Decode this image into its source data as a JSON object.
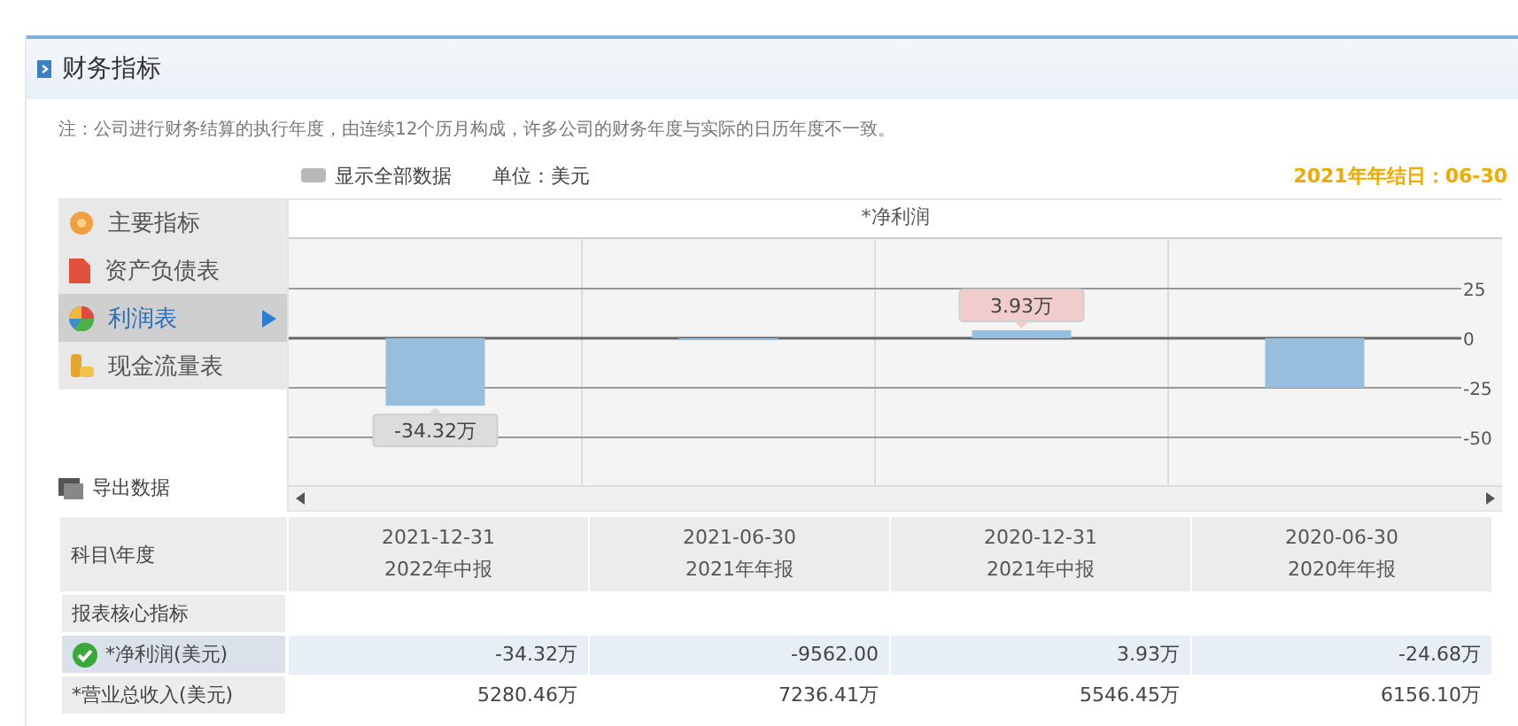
{
  "header": {
    "title": "财务指标"
  },
  "note": "注：公司进行财务结算的执行年度，由连续12个历月构成，许多公司的财务年度与实际的日历年度不一致。",
  "toolbar": {
    "toggle_label": "显示全部数据",
    "unit": "单位：美元",
    "year_end": "2021年年结日：06-30"
  },
  "menu": [
    {
      "label": "主要指标",
      "kind": "flower",
      "selected": false
    },
    {
      "label": "资产负债表",
      "kind": "sheet",
      "selected": false
    },
    {
      "label": "利润表",
      "kind": "ball",
      "selected": true
    },
    {
      "label": "现金流量表",
      "kind": "coins",
      "selected": false
    }
  ],
  "export_label": "导出数据",
  "chart": {
    "chart_data": {
      "type": "bar",
      "title": "*净利润",
      "series": [
        {
          "color": "#97bfdd",
          "values": [
            -34,
            -1,
            4,
            -25
          ]
        }
      ],
      "ylim": [
        -75,
        50
      ],
      "yticks": [
        25,
        0,
        -25,
        -50
      ],
      "grid": true,
      "annotations": [
        {
          "y": -34,
          "text": "-34.32万"
        },
        {
          "y": 4,
          "text": "3.93万"
        }
      ]
    }
  },
  "table": {
    "corner": "科目\\年度",
    "columns": [
      {
        "date": "2021-12-31",
        "report": "2022年中报"
      },
      {
        "date": "2021-06-30",
        "report": "2021年年报"
      },
      {
        "date": "2020-12-31",
        "report": "2021年中报"
      },
      {
        "date": "2020-06-30",
        "report": "2020年年报"
      }
    ],
    "rows": [
      {
        "label": "报表核心指标",
        "selected": false,
        "cells": []
      },
      {
        "label": "*净利润(美元)",
        "selected": true,
        "cells": [
          "-34.32万",
          "-9562.00",
          "3.93万",
          "-24.68万"
        ]
      },
      {
        "label": "*营业总收入(美元)",
        "selected": false,
        "cells": [
          "5280.46万",
          "7236.41万",
          "5546.45万",
          "6156.10万"
        ]
      }
    ]
  }
}
